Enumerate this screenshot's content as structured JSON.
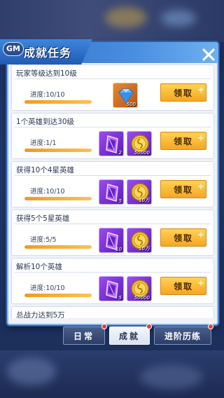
{
  "header": {
    "badge": "GM",
    "title": "成就任务"
  },
  "tasks": [
    {
      "title": "玩家等级达到10级",
      "progress_text": "进度:10/10",
      "progress": 1.0,
      "rewards": [
        {
          "icon": "diamond-icon",
          "count": "500",
          "style": "orange"
        }
      ],
      "claim_label": "领取"
    },
    {
      "title": "1个英雄到达30级",
      "progress_text": "进度:1/1",
      "progress": 1.0,
      "rewards": [
        {
          "icon": "purple-card-icon",
          "count": "2",
          "style": "purple"
        },
        {
          "icon": "gold-coin-icon",
          "count": "50000",
          "style": "purple"
        }
      ],
      "claim_label": "领取"
    },
    {
      "title": "获得10个4星英雄",
      "progress_text": "进度:10/10",
      "progress": 1.0,
      "rewards": [
        {
          "icon": "purple-card-icon",
          "count": "5",
          "style": "purple"
        },
        {
          "icon": "gold-coin-icon",
          "count": "10万",
          "style": "purple"
        }
      ],
      "claim_label": "领取"
    },
    {
      "title": "获得5个5星英雄",
      "progress_text": "进度:5/5",
      "progress": 1.0,
      "rewards": [
        {
          "icon": "purple-card-icon",
          "count": "10",
          "style": "purple"
        },
        {
          "icon": "gold-coin-icon",
          "count": "10万",
          "style": "purple"
        }
      ],
      "claim_label": "领取"
    },
    {
      "title": "解析10个英雄",
      "progress_text": "进度:10/10",
      "progress": 1.0,
      "rewards": [
        {
          "icon": "purple-card-icon",
          "count": "5",
          "style": "purple"
        },
        {
          "icon": "gold-coin-icon",
          "count": "50000",
          "style": "purple"
        }
      ],
      "claim_label": "领取"
    },
    {
      "title": "总战力达到5万",
      "progress_text": "",
      "progress": 0,
      "rewards": [],
      "claim_label": ""
    }
  ],
  "tabs": {
    "daily": "日常",
    "achievement": "成就",
    "advanced": "进阶历练"
  },
  "colors": {
    "claim": "#f6a623",
    "panel_header": "#2f6fc7",
    "red_dot": "#e8402a"
  }
}
